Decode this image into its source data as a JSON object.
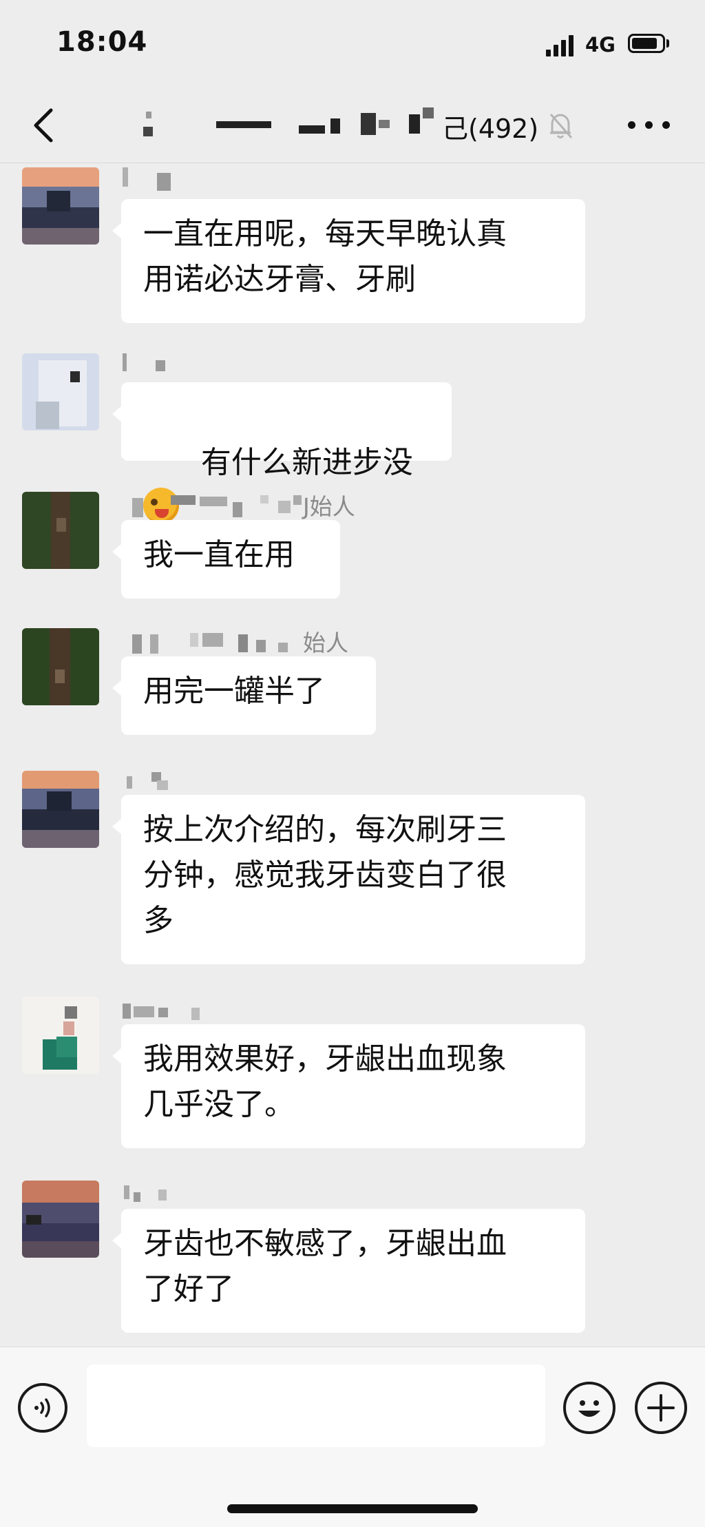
{
  "status_bar": {
    "time": "18:04",
    "network": "4G",
    "battery_level": 0.85
  },
  "nav": {
    "title_tail": "己(492)",
    "icons": {
      "back": "chevron-left-icon",
      "mute": "bell-off-icon",
      "more": "more-dots-icon"
    }
  },
  "messages": [
    {
      "sender_text": "",
      "text": "一直在用呢，每天早晚认真\n用诺必达牙膏、牙刷"
    },
    {
      "sender_text": "",
      "text": "有什么新进步没",
      "emoji": "winking-tongue-emoji"
    },
    {
      "sender_text": "J始人",
      "text": "我一直在用"
    },
    {
      "sender_text": "始人",
      "text": "用完一罐半了"
    },
    {
      "sender_text": "",
      "text": "按上次介绍的，每次刷牙三\n分钟，感觉我牙齿变白了很\n多"
    },
    {
      "sender_text": "",
      "text": "我用效果好，牙龈出血现象\n几乎没了。"
    },
    {
      "sender_text": "",
      "text": "牙齿也不敏感了，牙龈出血\n了好了"
    }
  ],
  "input_bar": {
    "placeholder": "",
    "icons": {
      "voice": "voice-icon",
      "emoji": "smiley-icon",
      "plus": "plus-icon"
    }
  }
}
